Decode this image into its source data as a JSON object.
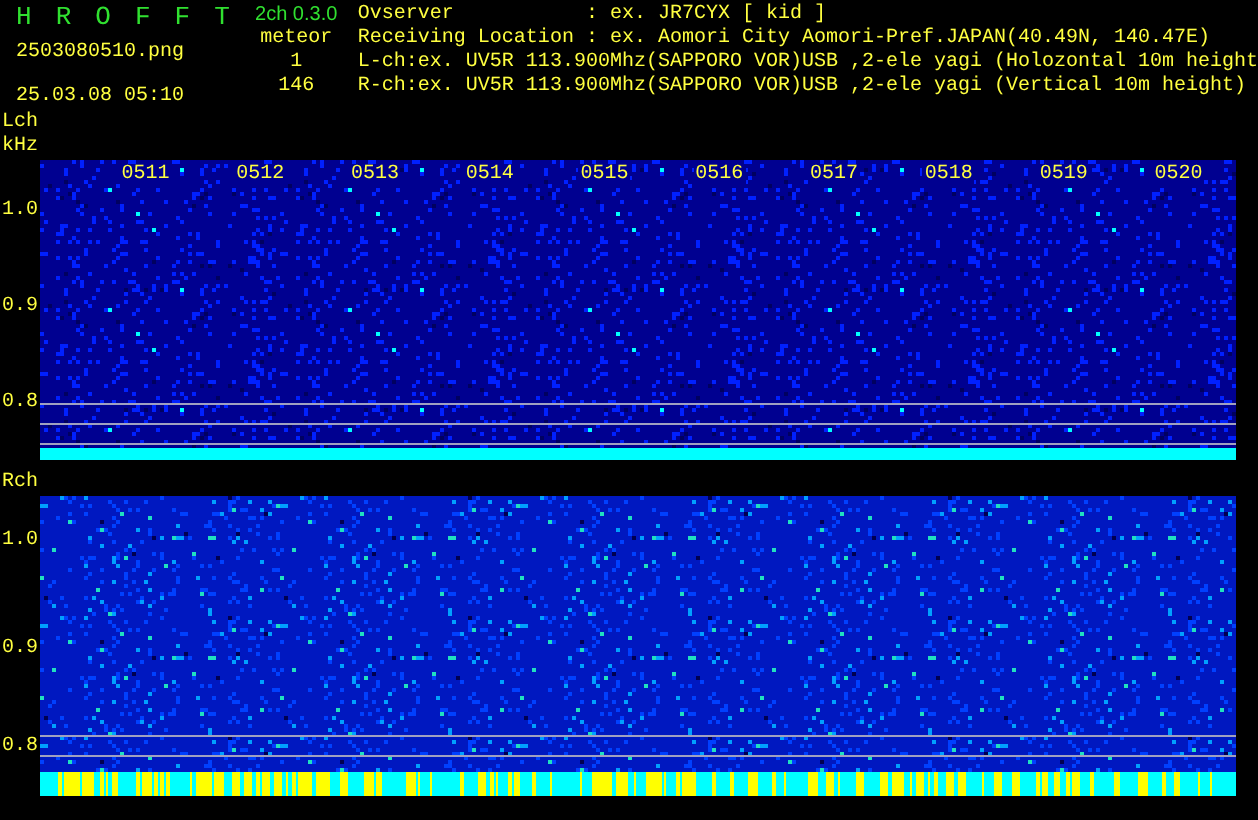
{
  "title": {
    "letters": [
      "H",
      "R",
      "O",
      "F",
      "F",
      "T"
    ],
    "version": "2ch 0.3.0"
  },
  "file": "2503080510.png",
  "datetime": "25.03.08 05:10",
  "counter": {
    "label": "meteor",
    "values": [
      "1",
      "146"
    ]
  },
  "info": [
    "Ovserver           : ex. JR7CYX [ kid ]",
    "Receiving Location : ex. Aomori City Aomori-Pref.JAPAN(40.49N, 140.47E)",
    "L-ch:ex. UV5R 113.900Mhz(SAPPORO VOR)USB ,2-ele yagi (Holozontal 10m height",
    "R-ch:ex. UV5R 113.900Mhz(SAPPORO VOR)USB ,2-ele yagi (Vertical 10m height)"
  ],
  "times": [
    "0511",
    "0512",
    "0513",
    "0514",
    "0515",
    "0516",
    "0517",
    "0518",
    "0519",
    "0520"
  ],
  "channels": [
    {
      "label": "Lch",
      "unit": "kHz",
      "yticks": [
        "1.0",
        "0.9",
        "0.8"
      ],
      "kind": "sparse"
    },
    {
      "label": "Rch",
      "yticks": [
        "1.0",
        "0.9",
        "0.8"
      ],
      "kind": "dense"
    }
  ]
}
